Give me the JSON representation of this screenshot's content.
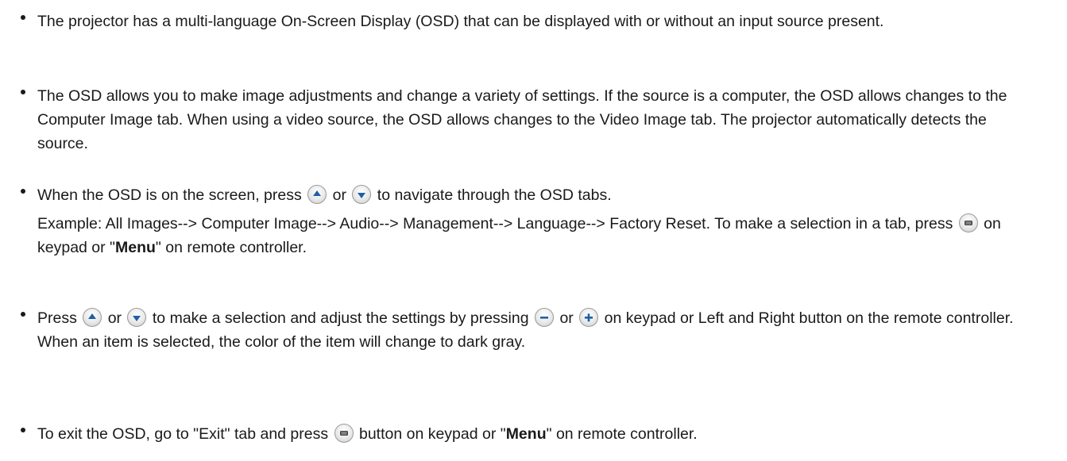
{
  "items": [
    {
      "text": "The projector has a multi-language On-Screen Display (OSD) that can be displayed with or without an input source present."
    },
    {
      "text": "The OSD allows you to make image adjustments and change a variety of settings. If the source is a computer, the OSD allows changes to the Computer Image tab. When using a video source, the OSD allows changes to the Video Image tab. The projector automatically detects the source."
    },
    {
      "t1": "When the OSD is on the screen, press",
      "t2": "or",
      "t3": "to navigate through the OSD tabs.",
      "example": "Example: All Images--> Computer Image--> Audio--> Management--> Language--> Factory Reset. To make a selection in a tab, press",
      "t4": "on keypad or \"",
      "menu": "Menu",
      "t5": "\" on remote controller."
    },
    {
      "t1": "Press",
      "t2": "or",
      "t3": "to make a selection and adjust the settings by pressing",
      "t4": "or",
      "t5": "on keypad or Left and Right button on the remote controller. When an item is selected, the color of the item will change to dark gray."
    },
    {
      "t1": "To exit the OSD, go to \"Exit\" tab and press",
      "t2": "button on keypad or \"",
      "menu": "Menu",
      "t3": "\" on remote controller."
    }
  ],
  "icons": {
    "up": "up-arrow-icon",
    "down": "down-arrow-icon",
    "menu": "menu-button-icon",
    "minus": "minus-icon",
    "plus": "plus-icon"
  },
  "colors": {
    "text": "#1a1a1a",
    "icon_glyph": "#1e5fa8",
    "icon_menu": "#444444"
  }
}
